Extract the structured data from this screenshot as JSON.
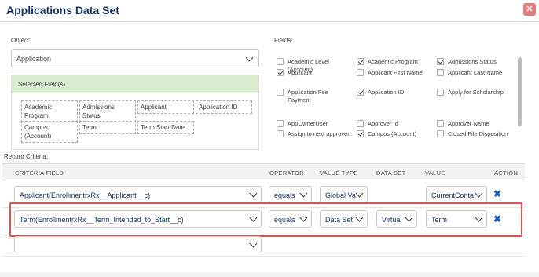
{
  "dialog": {
    "title": "Applications Data Set",
    "close_icon": "close-icon"
  },
  "object": {
    "label": "Object:",
    "value": "Application"
  },
  "selected": {
    "header": "Selected Field(s)",
    "chips": [
      "Academic Program",
      "Admissions Status",
      "Applicant",
      "Application ID",
      "Campus (Account)",
      "Term",
      "Term Start Date"
    ]
  },
  "fields": {
    "label": "Fields:",
    "items": [
      {
        "label": "Academic Level (Account)",
        "checked": false
      },
      {
        "label": "Academic Program",
        "checked": true
      },
      {
        "label": "Admissions Status",
        "checked": true
      },
      {
        "label": "Applicant",
        "checked": true
      },
      {
        "label": "Applicant First Name",
        "checked": false
      },
      {
        "label": "Applicant Last Name",
        "checked": false
      },
      {
        "label": "Application Fee Payment",
        "checked": false
      },
      {
        "label": "Application ID",
        "checked": true
      },
      {
        "label": "Apply for Scholarship",
        "checked": false
      },
      {
        "label": "AppOwnerUser",
        "checked": false
      },
      {
        "label": "Approver Id",
        "checked": false
      },
      {
        "label": "Approver Name",
        "checked": false
      },
      {
        "label": "Assign to next approver",
        "checked": false
      },
      {
        "label": "Campus (Account)",
        "checked": true
      },
      {
        "label": "Closed File Disposition",
        "checked": false
      }
    ]
  },
  "criteria": {
    "label": "Record Criteria:",
    "headers": {
      "field": "CRITERIA FIELD",
      "operator": "OPERATOR",
      "value_type": "VALUE TYPE",
      "data_set": "DATA SET",
      "value": "VALUE",
      "action": "ACTION"
    },
    "rows": [
      {
        "field": "Applicant(EnrollmentrxRx__Applicant__c)",
        "operator": "equals",
        "value_type": "Global Va",
        "data_set": "",
        "value": "CurrentConta"
      },
      {
        "field": "Term(EnrollmentrxRx__Term_Intended_to_Start__c)",
        "operator": "equals",
        "value_type": "Data Set",
        "data_set": "Virtual",
        "value": "Term"
      },
      {
        "field": ""
      }
    ]
  },
  "colors": {
    "accent": "#1b5fb3",
    "highlight": "#d9534f",
    "selected_header": "#d9ecd0",
    "close": "#e07e7e"
  }
}
